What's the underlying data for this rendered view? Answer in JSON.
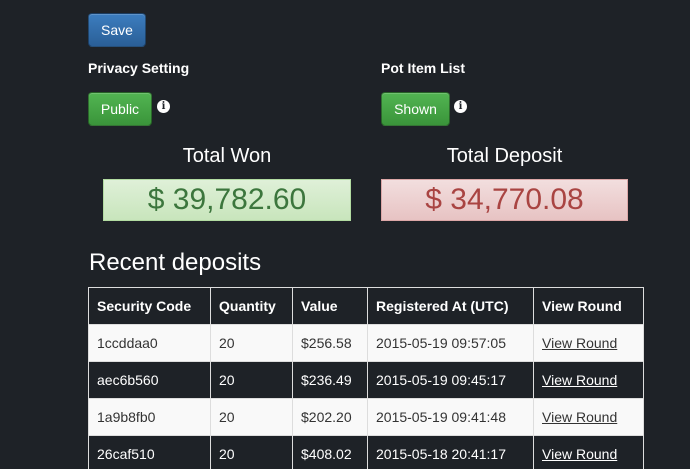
{
  "toolbar": {
    "save_label": "Save"
  },
  "privacy": {
    "label": "Privacy Setting",
    "button_label": "Public"
  },
  "pot_items": {
    "label": "Pot Item List",
    "button_label": "Shown"
  },
  "totals": {
    "won_heading": "Total Won",
    "won_value": "$ 39,782.60",
    "deposit_heading": "Total Deposit",
    "deposit_value": "$ 34,770.08"
  },
  "recent": {
    "title": "Recent deposits",
    "columns": [
      "Security Code",
      "Quantity",
      "Value",
      "Registered At (UTC)",
      "View Round"
    ],
    "rows": [
      {
        "code": "1ccddaa0",
        "quantity": "20",
        "value": "$256.58",
        "registered": "2015-05-19 09:57:05",
        "link": "View Round"
      },
      {
        "code": "aec6b560",
        "quantity": "20",
        "value": "$236.49",
        "registered": "2015-05-19 09:45:17",
        "link": "View Round"
      },
      {
        "code": "1a9b8fb0",
        "quantity": "20",
        "value": "$202.20",
        "registered": "2015-05-19 09:41:48",
        "link": "View Round"
      },
      {
        "code": "26caf510",
        "quantity": "20",
        "value": "$408.02",
        "registered": "2015-05-18 20:41:17",
        "link": "View Round"
      }
    ]
  },
  "icons": {
    "info": "info-icon"
  },
  "colors": {
    "background": "#1e2227",
    "primary": "#2a5f97",
    "success": "#3a943a",
    "won_text": "#3c763d",
    "deposit_text": "#a94442"
  }
}
